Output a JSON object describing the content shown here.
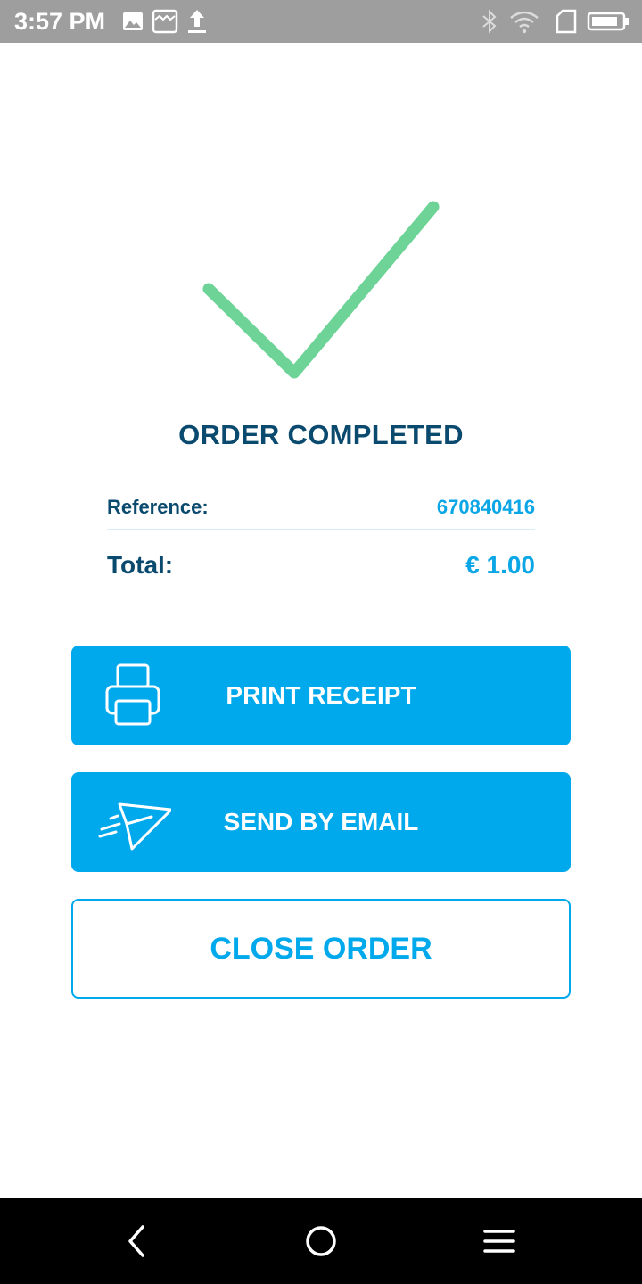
{
  "status_bar": {
    "time": "3:57 PM",
    "left_icons": [
      "image-icon",
      "store-icon",
      "upload-icon"
    ],
    "right_icons": [
      "bluetooth-icon",
      "wifi-icon",
      "sim-icon",
      "battery-icon"
    ]
  },
  "order": {
    "title": "ORDER COMPLETED",
    "reference_label": "Reference:",
    "reference_value": "670840416",
    "total_label": "Total:",
    "total_value": "€ 1.00"
  },
  "actions": {
    "print_label": "PRINT RECEIPT",
    "email_label": "SEND BY EMAIL",
    "close_label": "CLOSE ORDER"
  },
  "nav_bar": {
    "buttons": [
      "back-icon",
      "home-icon",
      "menu-icon"
    ]
  },
  "colors": {
    "accent": "#00a8ec",
    "title": "#0b4a6f",
    "check": "#6dd396",
    "status_bar": "#9e9e9e"
  }
}
